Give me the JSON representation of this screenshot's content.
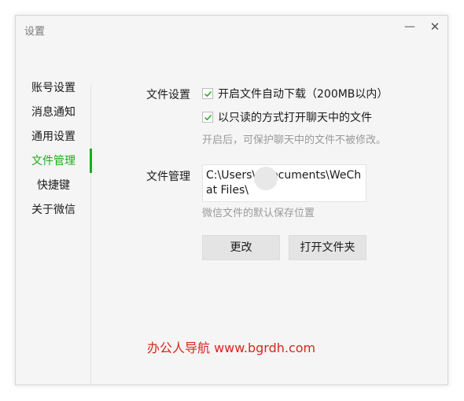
{
  "window": {
    "title": "设置",
    "minimize_icon": "minimize-icon",
    "close_icon": "close-icon"
  },
  "sidebar": {
    "items": [
      {
        "label": "账号设置"
      },
      {
        "label": "消息通知"
      },
      {
        "label": "通用设置"
      },
      {
        "label": "文件管理",
        "active": true
      },
      {
        "label": "快捷键"
      },
      {
        "label": "关于微信"
      }
    ]
  },
  "file_settings": {
    "label": "文件设置",
    "auto_download": {
      "label": "开启文件自动下载（200MB以内）",
      "checked": true
    },
    "read_only": {
      "label": "以只读的方式打开聊天中的文件",
      "checked": true
    },
    "hint": "开启后，可保护聊天中的文件不被修改。"
  },
  "file_management": {
    "label": "文件管理",
    "path": "C:\\Users\\      \\Documents\\WeChat Files\\",
    "hint": "微信文件的默认保存位置",
    "change_button": "更改",
    "open_folder_button": "打开文件夹"
  },
  "watermark": "办公人导航 www.bgrdh.com",
  "colors": {
    "accent": "#1aad19",
    "watermark": "#d8261f"
  }
}
